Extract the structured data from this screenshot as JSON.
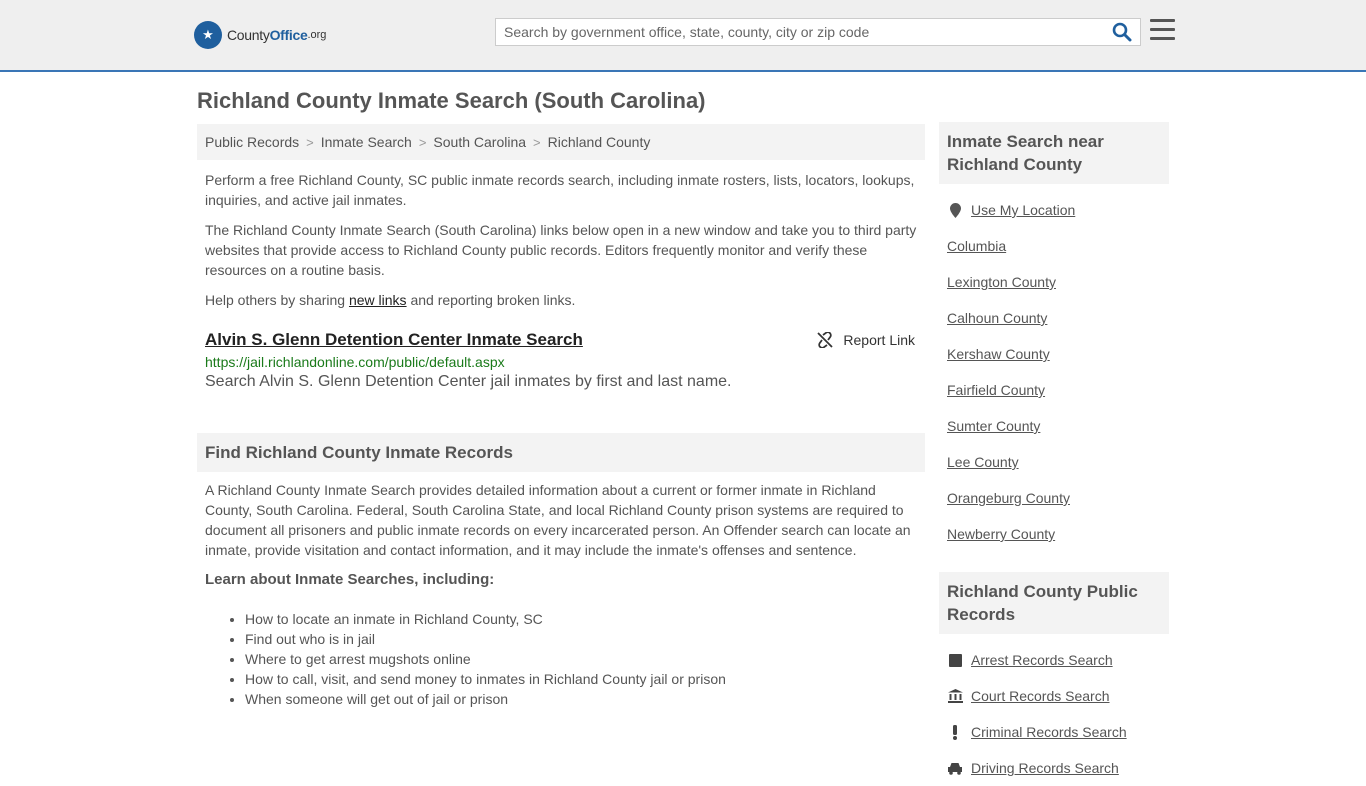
{
  "header": {
    "logo_county": "County",
    "logo_office": "Office",
    "logo_tld": ".org",
    "search_placeholder": "Search by government office, state, county, city or zip code",
    "accent_color": "#3a76b6"
  },
  "page_title": "Richland County Inmate Search (South Carolina)",
  "breadcrumb": [
    "Public Records",
    "Inmate Search",
    "South Carolina",
    "Richland County"
  ],
  "intro": {
    "p1": "Perform a free Richland County, SC public inmate records search, including inmate rosters, lists, locators, lookups, inquiries, and active jail inmates.",
    "p2": "The Richland County Inmate Search (South Carolina) links below open in a new window and take you to third party websites that provide access to Richland County public records. Editors frequently monitor and verify these resources on a routine basis.",
    "p3_before": "Help others by sharing ",
    "p3_link": "new links",
    "p3_after": " and reporting broken links."
  },
  "result": {
    "title": "Alvin S. Glenn Detention Center Inmate Search",
    "url": "https://jail.richlandonline.com/public/default.aspx",
    "description": "Search Alvin S. Glenn Detention Center jail inmates by first and last name.",
    "report_label": "Report Link"
  },
  "find_section": {
    "heading": "Find Richland County Inmate Records",
    "body": "A Richland County Inmate Search provides detailed information about a current or former inmate in Richland County, South Carolina. Federal, South Carolina State, and local Richland County prison systems are required to document all prisoners and public inmate records on every incarcerated person. An Offender search can locate an inmate, provide visitation and contact information, and it may include the inmate's offenses and sentence.",
    "learn_heading": "Learn about Inmate Searches, including:",
    "learn_items": [
      "How to locate an inmate in Richland County, SC",
      "Find out who is in jail",
      "Where to get arrest mugshots online",
      "How to call, visit, and send money to inmates in Richland County jail or prison",
      "When someone will get out of jail or prison"
    ]
  },
  "sidebar": {
    "near_heading": "Inmate Search near Richland County",
    "use_location": "Use My Location",
    "near_items": [
      "Columbia",
      "Lexington County",
      "Calhoun County",
      "Kershaw County",
      "Fairfield County",
      "Sumter County",
      "Lee County",
      "Orangeburg County",
      "Newberry County"
    ],
    "records_heading": "Richland County Public Records",
    "records_items": [
      {
        "label": "Arrest Records Search",
        "icon": "square-icon"
      },
      {
        "label": "Court Records Search",
        "icon": "courthouse-icon"
      },
      {
        "label": "Criminal Records Search",
        "icon": "exclamation-icon"
      },
      {
        "label": "Driving Records Search",
        "icon": "car-icon"
      }
    ]
  }
}
